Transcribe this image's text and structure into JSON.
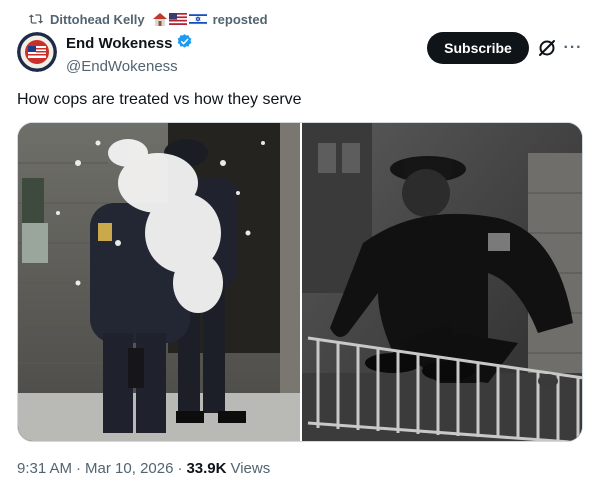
{
  "repost": {
    "reposter_name": "Dittohead Kelly",
    "label": "reposted"
  },
  "author": {
    "display_name": "End Wokeness",
    "handle": "@EndWokeness",
    "verified_color": "#1d9bf0"
  },
  "actions": {
    "subscribe_label": "Subscribe",
    "more_label": "···"
  },
  "tweet": {
    "text": "How cops are treated vs how they serve"
  },
  "meta": {
    "time": "9:31 AM",
    "separator": "·",
    "date": "Mar 10, 2026",
    "views_count": "33.9K",
    "views_label": "Views"
  },
  "colors": {
    "text_primary": "#0f1419",
    "text_secondary": "#536471",
    "subscribe_bg": "#0f1419",
    "border": "#cfd9de"
  },
  "icons": {
    "repost": "repost-icon",
    "verified": "verified-badge-icon",
    "grok": "grok-icon",
    "more": "more-icon"
  }
}
